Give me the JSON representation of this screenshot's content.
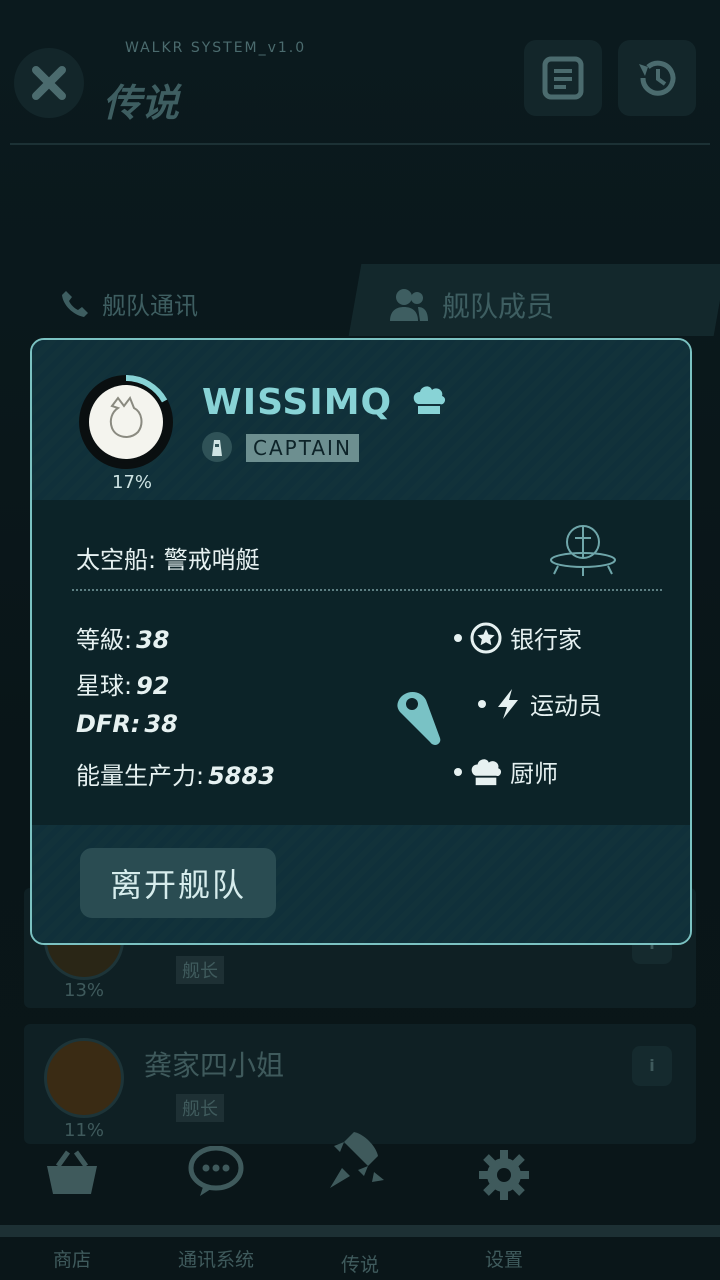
{
  "header": {
    "system_label": "WALKR SYSTEM_v1.0",
    "title": "传说"
  },
  "tabs": [
    {
      "label": "舰队通讯"
    },
    {
      "label": "舰队成员"
    }
  ],
  "list": [
    {
      "percent": "13%",
      "rank": "舰长"
    },
    {
      "name": "龚家四小姐",
      "percent": "11%",
      "rank": "舰长"
    }
  ],
  "modal": {
    "player_name": "WISSIMQ",
    "role_badge": "CAPTAIN",
    "progress": "17%",
    "progress_value": 0.17,
    "ship_label": "太空船:",
    "ship_value": "警戒哨艇",
    "stats": [
      {
        "label": "等級:",
        "value": "38"
      },
      {
        "label": "星球:",
        "value": "92"
      },
      {
        "label": "DFR:",
        "value": "38"
      },
      {
        "label": "能量生产力:",
        "value": "5883"
      }
    ],
    "roles": [
      {
        "label": "银行家",
        "icon": "star-coin-icon"
      },
      {
        "label": "运动员",
        "icon": "lightning-icon"
      },
      {
        "label": "厨师",
        "icon": "chef-hat-icon"
      }
    ],
    "leave_button": "离开舰队"
  },
  "nav": [
    {
      "label": "商店",
      "icon": "basket-icon"
    },
    {
      "label": "通讯系统",
      "icon": "chat-icon"
    },
    {
      "label": "传说",
      "icon": "rocket-icon"
    },
    {
      "label": "设置",
      "icon": "gear-icon"
    }
  ],
  "colors": {
    "accent": "#88d3d6",
    "modal_border": "#7bc2c2",
    "background": "#0a1417"
  }
}
